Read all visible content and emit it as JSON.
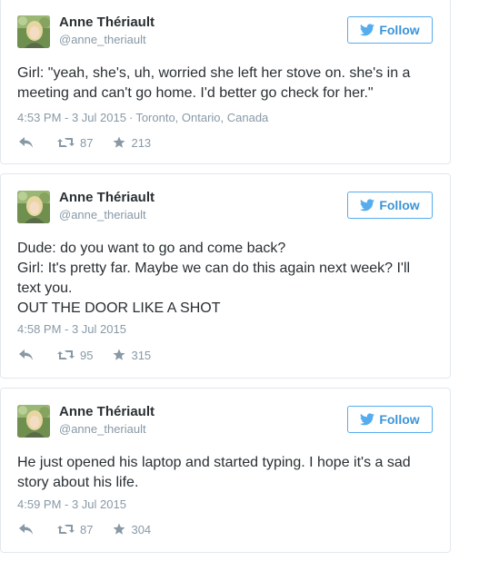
{
  "colors": {
    "accent": "#55acee",
    "text": "#292f33",
    "muted": "#8899a6",
    "border": "#e1e8ed"
  },
  "tweets": [
    {
      "author": "Anne Thériault",
      "handle": "@anne_theriault",
      "follow_label": "Follow",
      "text": "Girl: \"yeah, she's, uh, worried she left her stove on. she's in a meeting and can't go home. I'd better go check for her.\"",
      "time": "4:53 PM - 3 Jul 2015",
      "location": "Toronto, Ontario, Canada",
      "retweets": "87",
      "favorites": "213"
    },
    {
      "author": "Anne Thériault",
      "handle": "@anne_theriault",
      "follow_label": "Follow",
      "text": "Dude: do you want to go and come back?\nGirl: It's pretty far. Maybe we can do this again next week? I'll text you.\nOUT THE DOOR LIKE A SHOT",
      "time": "4:58 PM - 3 Jul 2015",
      "retweets": "95",
      "favorites": "315"
    },
    {
      "author": "Anne Thériault",
      "handle": "@anne_theriault",
      "follow_label": "Follow",
      "text": "He just opened his laptop and started typing. I hope it's a sad story about his life.",
      "time": "4:59 PM - 3 Jul 2015",
      "retweets": "87",
      "favorites": "304"
    }
  ]
}
